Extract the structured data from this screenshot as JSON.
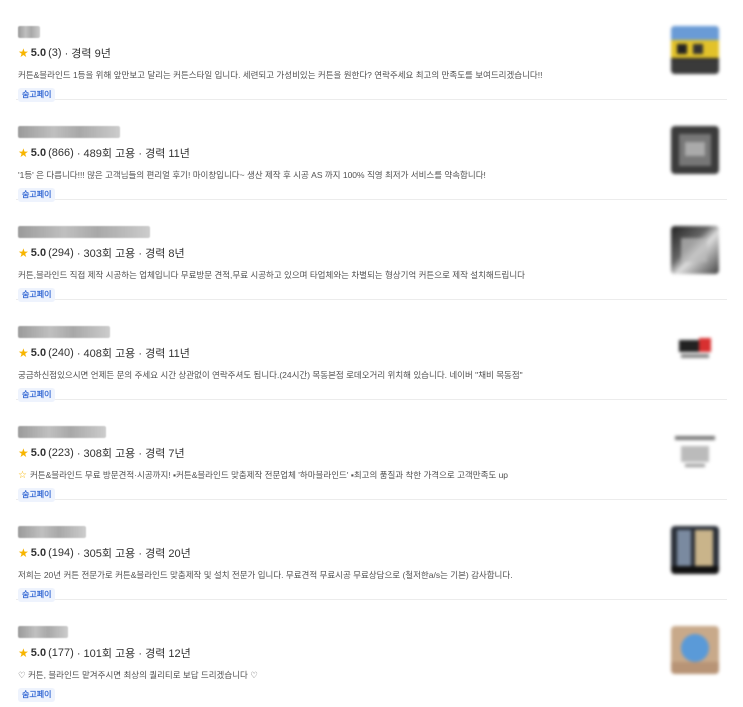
{
  "experts": [
    {
      "rating": "5.0",
      "reviews": "(3)",
      "stats": "· 경력 9년",
      "description": "커튼&블라인드 1등을 위해 앞만보고 달리는 커튼스타일 입니다. 세련되고 가성비있는 커튼을 원한다? 연락주세요 최고의 만족도를 보여드리겠습니다!!",
      "badge": "숨고페이",
      "thumb_icon": "curtain-photo-icon"
    },
    {
      "rating": "5.0",
      "reviews": "(866)",
      "stats": "· 489회 고용 · 경력 11년",
      "description": "'1등' 은 다릅니다!!! 많은 고객님들의 편리얼 후기! 마이창입니다~ 생산 제작 후 시공 AS 까지 100% 직영 최저가 서비스를 약속합니다!",
      "badge": "숨고페이",
      "thumb_icon": "logo-photo-icon"
    },
    {
      "rating": "5.0",
      "reviews": "(294)",
      "stats": "· 303회 고용 · 경력 8년",
      "description": "커튼,블라인드 직접 제작 시공하는 업체입니다 무료방문 견적,무료 시공하고 있으며 타업체와는 차별되는 형상기억 커튼으로 제작 설치해드립니다",
      "badge": "숨고페이",
      "thumb_icon": "interior-photo-icon"
    },
    {
      "rating": "5.0",
      "reviews": "(240)",
      "stats": "· 408회 고용 · 경력 11년",
      "description": "궁금하신점있으시면 언제든 문의 주세요 시간 상관없이 연락주셔도 됩니다.(24시간) 목동본점 로데오거리 위치해 있습니다. 네이버 \"채비 목동점\"",
      "badge": "숨고페이",
      "thumb_icon": "brand-logo-icon"
    },
    {
      "rating": "5.0",
      "reviews": "(223)",
      "stats": "· 308회 고용 · 경력 7년",
      "description": "커튼&블라인드 무료 방문견적·시공까지! ▪커튼&블라인드 맞춤제작 전문업체 '하마블라인드' ▪최고의 품질과 착한 가격으로 고객만족도 up",
      "desc_icon": "☆",
      "badge": "숨고페이",
      "thumb_icon": "text-logo-icon"
    },
    {
      "rating": "5.0",
      "reviews": "(194)",
      "stats": "· 305회 고용 · 경력 20년",
      "description": "저희는 20년 커튼 전문가로 커튼&블라인드 맞춤제작 및 설치 전문가 입니다. 무료견적 무료시공 무료상담으로 (철저한a/s는 기본) 감사합니다.",
      "badge": "숨고페이",
      "thumb_icon": "window-photo-icon"
    },
    {
      "rating": "5.0",
      "reviews": "(177)",
      "stats": "· 101회 고용 · 경력 12년",
      "description": "♡ 커튼, 블라인드 맡겨주시면 최상의 퀄리티로 보답 드리겠습니다 ♡",
      "badge": "숨고페이",
      "thumb_icon": "profile-photo-icon"
    }
  ],
  "colors": {
    "star": "#f7b500",
    "badge_text": "#3d6fd6",
    "badge_bg": "#eef3fd",
    "divider": "#ececec"
  }
}
